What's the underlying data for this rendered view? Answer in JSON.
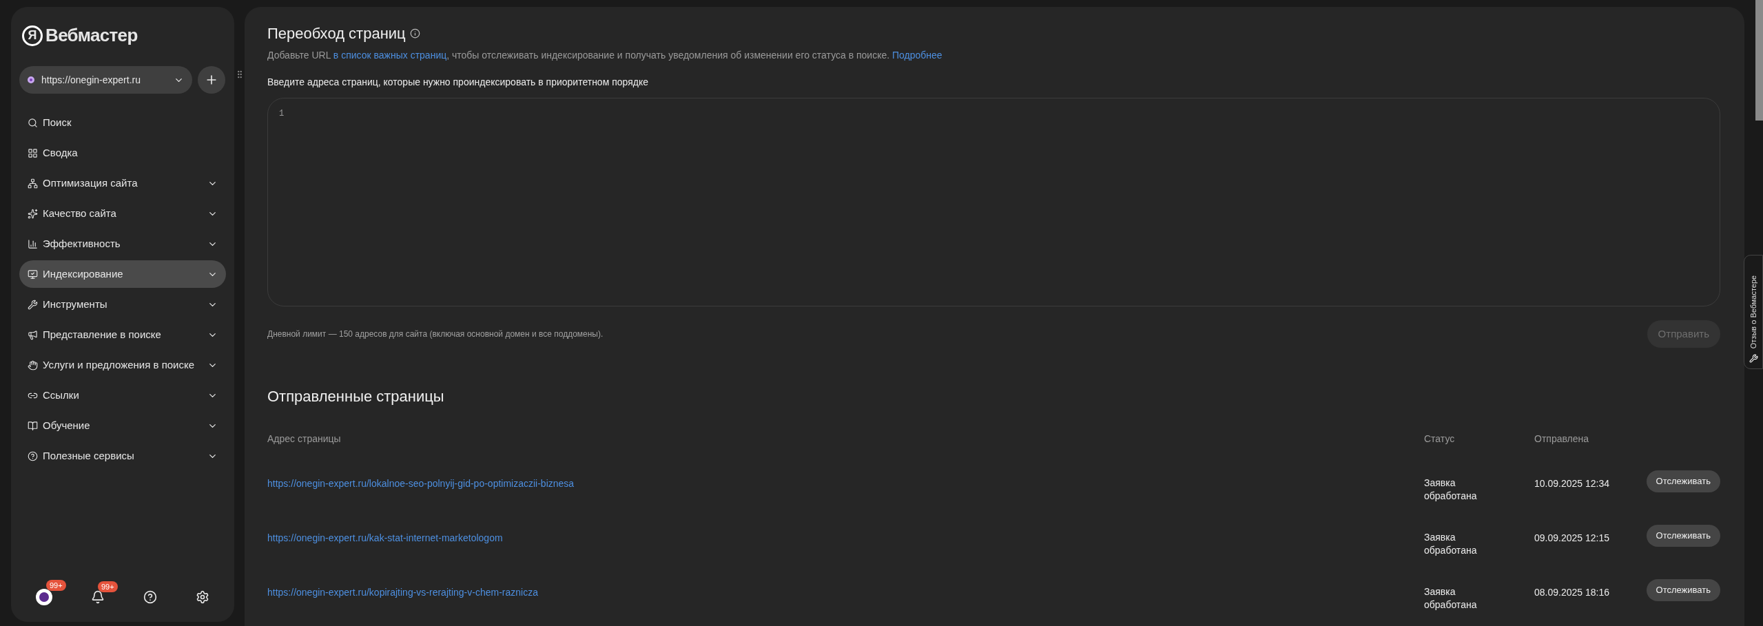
{
  "sidebar": {
    "logo_mark": "Я",
    "logo_text": "Вебмастер",
    "site": {
      "url": "https://onegin-expert.ru"
    },
    "items": [
      {
        "label": "Поиск",
        "kind": "link",
        "selected": false
      },
      {
        "label": "Сводка",
        "kind": "link",
        "selected": false
      },
      {
        "label": "Оптимизация сайта",
        "kind": "group",
        "selected": false,
        "expanded": false
      },
      {
        "label": "Качество сайта",
        "kind": "group",
        "selected": false,
        "expanded": false
      },
      {
        "label": "Эффективность",
        "kind": "group",
        "selected": false,
        "expanded": false
      },
      {
        "label": "Индексирование",
        "kind": "group",
        "selected": true,
        "expanded": false
      },
      {
        "label": "Инструменты",
        "kind": "group",
        "selected": false,
        "expanded": false
      },
      {
        "label": "Представление в поиске",
        "kind": "group",
        "selected": false,
        "expanded": false
      },
      {
        "label": "Услуги и предложения в поиске",
        "kind": "group",
        "selected": false,
        "expanded": false
      },
      {
        "label": "Ссылки",
        "kind": "group",
        "selected": false,
        "expanded": false
      },
      {
        "label": "Обучение",
        "kind": "group",
        "selected": false,
        "expanded": false
      },
      {
        "label": "Полезные сервисы",
        "kind": "group",
        "selected": false,
        "expanded": false
      }
    ],
    "footer": {
      "messages_badge": "99+",
      "notifications_badge": "99+"
    }
  },
  "main": {
    "title": "Переобход страниц",
    "description": {
      "before": "Добавьте URL",
      "link": "в список важных страниц",
      "after": ", чтобы отслеживать индексирование и получать уведомления об изменении его статуса в поиске.",
      "more_link": "Подробнее"
    },
    "input_label": "Введите адреса страниц, которые нужно проиндексировать в приоритетном порядке",
    "editor": {
      "line_number": "1"
    },
    "limit_note": "Дневной лимит — 150 адресов для сайта (включая основной домен и все поддомены).",
    "send_button": {
      "label": "Отправить",
      "disabled": true
    },
    "sent": {
      "title": "Отправленные страницы",
      "columns": [
        "Адрес страницы",
        "Статус",
        "Отправлена"
      ],
      "rows": [
        {
          "url": "https://onegin-expert.ru/lokalnoe-seo-polnyij-gid-po-optimizaczii-biznesa",
          "status": "Заявка обработана",
          "sent": "10.09.2025 12:34",
          "action": "Отслеживать"
        },
        {
          "url": "https://onegin-expert.ru/kak-stat-internet-marketologom",
          "status": "Заявка обработана",
          "sent": "09.09.2025 12:15",
          "action": "Отслеживать"
        },
        {
          "url": "https://onegin-expert.ru/kopirajting-vs-rerajting-v-chem-raznicza",
          "status": "Заявка обработана",
          "sent": "08.09.2025 18:16",
          "action": "Отслеживать"
        }
      ]
    }
  },
  "feedback_tab": {
    "label": "Отзыв о Вебмастере"
  }
}
